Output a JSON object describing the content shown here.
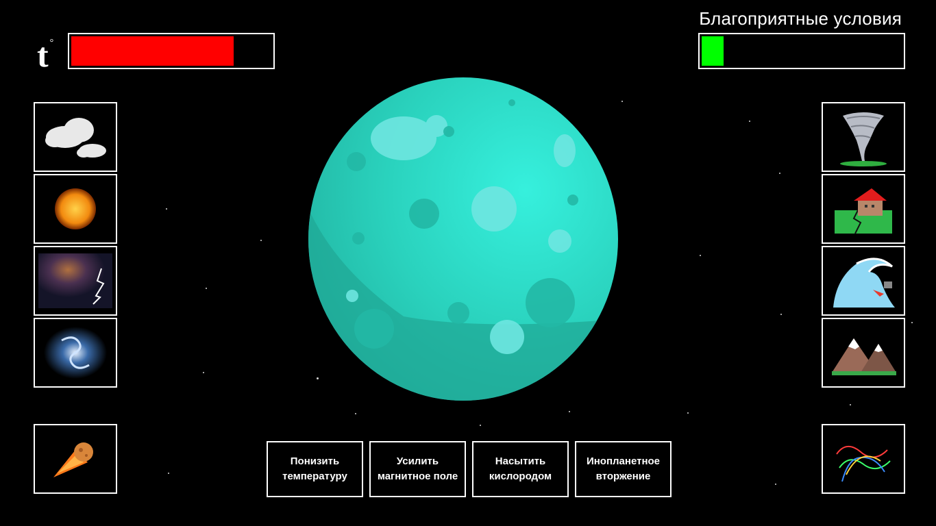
{
  "hud": {
    "temperature_label": "t",
    "temperature_unit": "°",
    "temperature_level_percent": 81,
    "conditions_title": "Благоприятные условия",
    "conditions_level_percent": 11,
    "colors": {
      "temperature": "#ff0000",
      "conditions": "#00ff00",
      "planet": "#2fe0c8"
    }
  },
  "left_tiles": [
    {
      "icon": "cloud-icon"
    },
    {
      "icon": "sun-icon"
    },
    {
      "icon": "storm-lightning-icon"
    },
    {
      "icon": "galaxy-spiral-icon"
    },
    {
      "icon": "meteor-icon"
    }
  ],
  "right_tiles": [
    {
      "icon": "tornado-icon"
    },
    {
      "icon": "earthquake-house-icon"
    },
    {
      "icon": "tsunami-wave-icon"
    },
    {
      "icon": "mountains-icon"
    },
    {
      "icon": "dna-helix-icon"
    }
  ],
  "actions": [
    {
      "label": "Понизить температуру"
    },
    {
      "label": "Усилить магнитное поле"
    },
    {
      "label": "Насытить кислородом"
    },
    {
      "label": "Инопланетное вторжение"
    }
  ]
}
